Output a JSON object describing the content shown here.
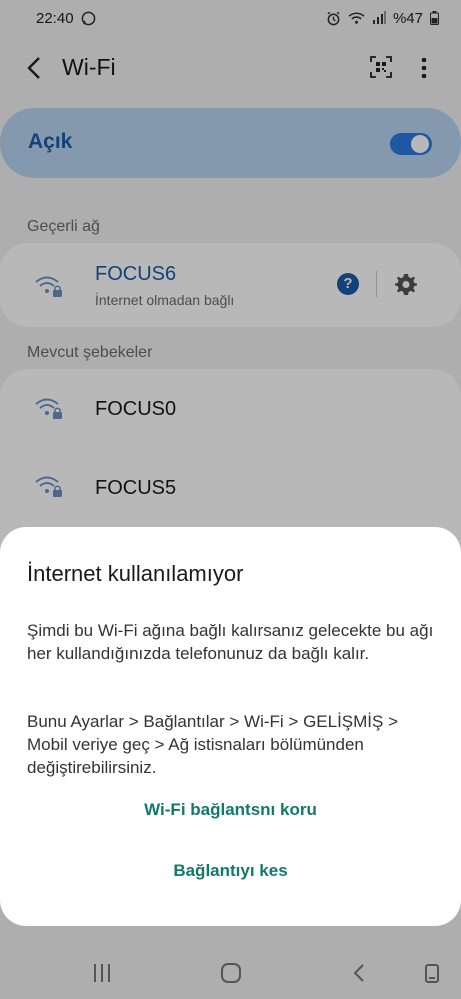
{
  "status_bar": {
    "time": "22:40",
    "battery": "%47"
  },
  "app_bar": {
    "title": "Wi-Fi"
  },
  "master_switch": {
    "label": "Açık",
    "on": true
  },
  "current_network": {
    "section_label": "Geçerli ağ",
    "name": "FOCUS6",
    "status": "İnternet olmadan bağlı"
  },
  "available_networks": {
    "section_label": "Mevcut şebekeler",
    "items": [
      {
        "name": "FOCUS0"
      },
      {
        "name": "FOCUS5"
      }
    ]
  },
  "dialog": {
    "title": "İnternet kullanılamıyor",
    "paragraph_1": "Şimdi bu Wi-Fi ağına bağlı kalırsanız gelecekte bu ağı her kullandığınızda telefonunuz da bağlı kalır.",
    "paragraph_2": "Bunu Ayarlar > Bağlantılar > Wi-Fi > GELİŞMİŞ > Mobil veriye geç > Ağ istisnaları bölümünden değiştirebilirsiniz.",
    "keep_button": "Wi-Fi bağlantsnı koru",
    "disconnect_button": "Bağlantıyı kes"
  },
  "colors": {
    "accent_blue": "#1c5aa8",
    "toggle_blue": "#2a7ae2",
    "dialog_button_teal": "#107a6b",
    "master_bg": "#b9d4f1"
  },
  "icons": [
    "whatsapp-icon",
    "alarm-icon",
    "wifi-status-icon",
    "signal-icon",
    "battery-icon",
    "back-arrow-icon",
    "qr-scan-icon",
    "more-options-icon",
    "wifi-lock-icon",
    "help-icon",
    "gear-icon",
    "recents-icon",
    "home-icon",
    "back-nav-icon",
    "rotate-icon"
  ]
}
